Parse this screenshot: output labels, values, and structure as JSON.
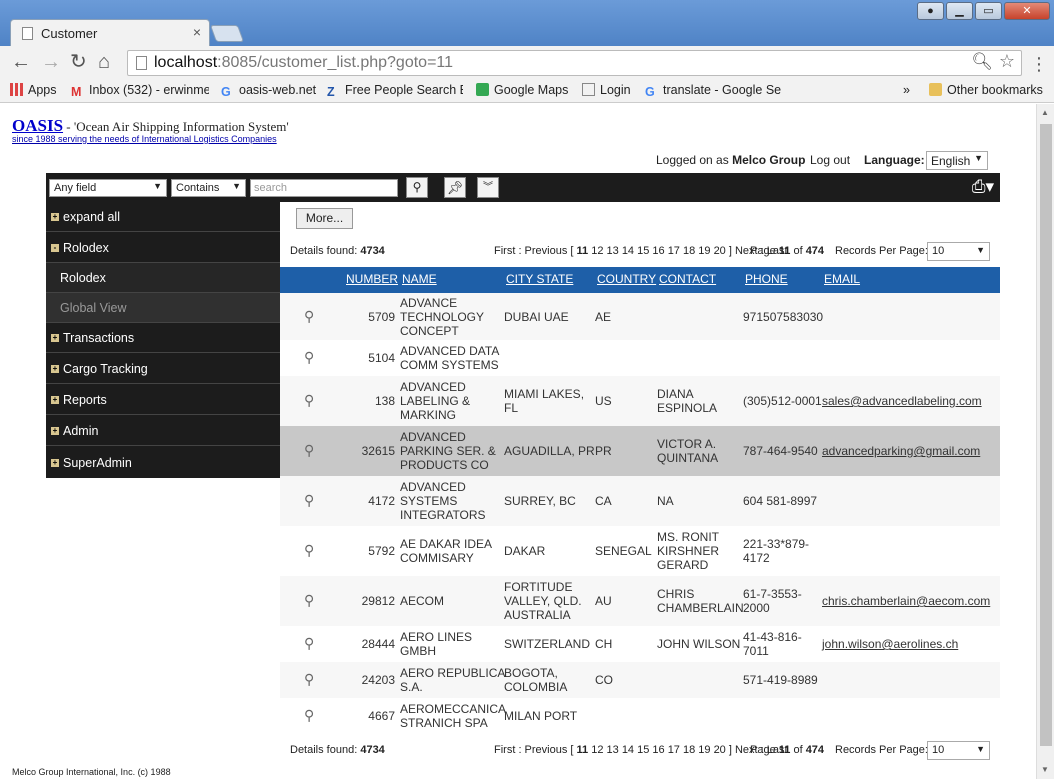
{
  "browser": {
    "tab_title": "Customer",
    "tab_close": "×",
    "url_host": "localhost",
    "url_rest": ":8085/customer_list.php?goto=11",
    "bookmarks": [
      {
        "label": "Apps",
        "color": "#d44"
      },
      {
        "label": "Inbox (532) - erwinme",
        "color": "#d33"
      },
      {
        "label": "oasis-web.net",
        "color": "#4285f4"
      },
      {
        "label": "Free People Search En",
        "color": "#2255aa"
      },
      {
        "label": "Google Maps",
        "color": "#34a853"
      },
      {
        "label": "Login",
        "color": "#888"
      },
      {
        "label": "translate - Google Se",
        "color": "#4285f4"
      }
    ],
    "more_bookmarks": "»",
    "other_bookmarks": "Other bookmarks"
  },
  "app": {
    "logo": "OASIS",
    "tagline": " - 'Ocean Air Shipping Information System'",
    "subtitle": "since 1988 serving the needs of International Logistics Companies",
    "logged_prefix": "Logged on as ",
    "logged_user": "Melco Group",
    "logout": "Log out",
    "language_label": "Language:",
    "language_value": "English",
    "footer": "Melco Group International, Inc. (c) 1988"
  },
  "toolbar": {
    "field_select": "Any field",
    "op_select": "Contains",
    "search_placeholder": "search"
  },
  "sidebar": {
    "items": [
      {
        "label": "expand all",
        "icon": "+"
      },
      {
        "label": "Rolodex",
        "icon": "-"
      },
      {
        "label": "Rolodex"
      },
      {
        "label": "Global View"
      },
      {
        "label": "Transactions",
        "icon": "+"
      },
      {
        "label": "Cargo Tracking",
        "icon": "+"
      },
      {
        "label": "Reports",
        "icon": "+"
      },
      {
        "label": "Admin",
        "icon": "+"
      },
      {
        "label": "SuperAdmin",
        "icon": "+"
      }
    ]
  },
  "content": {
    "more_button": "More...",
    "details_found_label": "Details found: ",
    "details_found": "4734",
    "pager_prefix": "First : Previous [ ",
    "current_page": "11",
    "pages": "12 13 14 15 16 17 18 19 20",
    "pager_suffix": " ] Next : Last",
    "page_of_prefix": "Page ",
    "page_of_current": "11",
    "page_of_mid": " of ",
    "page_total": "474",
    "records_per_page_label": "Records Per Page:",
    "records_per_page": "10"
  },
  "table": {
    "headers": [
      "NUMBER",
      "NAME",
      "CITY STATE",
      "COUNTRY",
      "CONTACT",
      "PHONE",
      "EMAIL"
    ],
    "rows": [
      {
        "number": "5709",
        "name": [
          "ADVANCE",
          "TECHNOLOGY",
          "CONCEPT"
        ],
        "city": [
          "DUBAI UAE"
        ],
        "country": "AE",
        "contact": [],
        "phone": [
          "971507583030"
        ],
        "email": ""
      },
      {
        "number": "5104",
        "name": [
          "ADVANCED DATA",
          "COMM SYSTEMS"
        ],
        "city": [],
        "country": "",
        "contact": [],
        "phone": [],
        "email": ""
      },
      {
        "number": "138",
        "name": [
          "ADVANCED",
          "LABELING &",
          "MARKING"
        ],
        "city": [
          "MIAMI LAKES,",
          "FL"
        ],
        "country": "US",
        "contact": [
          "DIANA",
          "ESPINOLA"
        ],
        "phone": [
          "(305)512-0001"
        ],
        "email": "sales@advancedlabeling.com"
      },
      {
        "number": "32615",
        "name": [
          "ADVANCED",
          "PARKING SER. &",
          "PRODUCTS CO"
        ],
        "city": [
          "AGUADILLA, PR"
        ],
        "country": "PR",
        "contact": [
          "VICTOR A.",
          "QUINTANA"
        ],
        "phone": [
          "787-464-9540"
        ],
        "email": "advancedparking@gmail.com"
      },
      {
        "number": "4172",
        "name": [
          "ADVANCED",
          "SYSTEMS",
          "INTEGRATORS"
        ],
        "city": [
          "SURREY, BC"
        ],
        "country": "CA",
        "contact": [
          "NA"
        ],
        "phone": [
          "604 581-8997"
        ],
        "email": ""
      },
      {
        "number": "5792",
        "name": [
          "AE DAKAR IDEA",
          "COMMISARY"
        ],
        "city": [
          "DAKAR"
        ],
        "country": "SENEGAL",
        "contact": [
          "MS. RONIT",
          "KIRSHNER",
          "GERARD"
        ],
        "phone": [
          "221-33*879-",
          "4172"
        ],
        "email": ""
      },
      {
        "number": "29812",
        "name": [
          "AECOM"
        ],
        "city": [
          "FORTITUDE",
          "VALLEY, QLD.",
          "AUSTRALIA"
        ],
        "country": "AU",
        "contact": [
          "CHRIS",
          "CHAMBERLAIN"
        ],
        "phone": [
          "61-7-3553-",
          "2000"
        ],
        "email": "chris.chamberlain@aecom.com"
      },
      {
        "number": "28444",
        "name": [
          "AERO LINES",
          "GMBH"
        ],
        "city": [
          "SWITZERLAND"
        ],
        "country": "CH",
        "contact": [
          "JOHN WILSON"
        ],
        "phone": [
          "41-43-816-",
          "7011"
        ],
        "email": "john.wilson@aerolines.ch"
      },
      {
        "number": "24203",
        "name": [
          "AERO REPUBLICA",
          "S.A."
        ],
        "city": [
          "BOGOTA,",
          "COLOMBIA"
        ],
        "country": "CO",
        "contact": [],
        "phone": [
          "571-419-8989"
        ],
        "email": ""
      },
      {
        "number": "4667",
        "name": [
          "AEROMECCANICA",
          "STRANICH SPA"
        ],
        "city": [
          "MILAN PORT"
        ],
        "country": "",
        "contact": [],
        "phone": [],
        "email": ""
      }
    ]
  }
}
